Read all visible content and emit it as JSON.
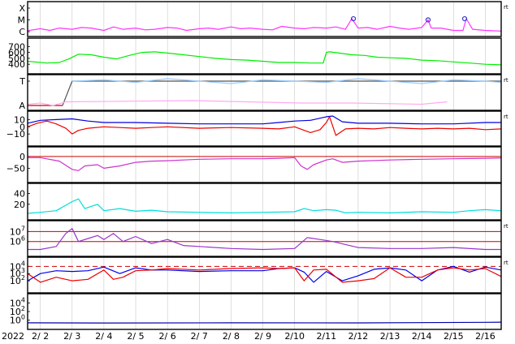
{
  "chart_data": {
    "type": "line",
    "year_label": "2022",
    "x_tick_labels": [
      "2/ 2",
      "2/ 3",
      "2/ 4",
      "2/ 5",
      "2/ 6",
      "2/ 7",
      "2/ 8",
      "2/ 9",
      "2/10",
      "2/11",
      "2/12",
      "2/13",
      "2/14",
      "2/15",
      "2/16"
    ],
    "x_range": [
      1.6,
      16.5
    ],
    "panels": [
      {
        "id": "xray",
        "tick_labels": [
          "X",
          "M",
          "C"
        ],
        "right_mark": "rt",
        "series": [
          {
            "color": "#ff33ff",
            "x": [
              1.6,
              2.0,
              2.3,
              2.6,
              3.0,
              3.3,
              3.6,
              4.0,
              4.3,
              4.6,
              5.0,
              5.3,
              5.6,
              6.0,
              6.3,
              6.6,
              7.0,
              7.3,
              7.6,
              8.0,
              8.3,
              8.6,
              9.0,
              9.3,
              9.6,
              10.0,
              10.3,
              10.6,
              11.0,
              11.3,
              11.6,
              11.8,
              12.0,
              12.3,
              12.6,
              13.0,
              13.3,
              13.6,
              14.0,
              14.2,
              14.3,
              14.6,
              15.0,
              15.3,
              15.4,
              15.6,
              16.0,
              16.5
            ],
            "y": [
              0.08,
              0.25,
              0.1,
              0.3,
              0.2,
              0.35,
              0.3,
              0.1,
              0.4,
              0.2,
              0.3,
              0.15,
              0.2,
              0.35,
              0.3,
              0.1,
              0.25,
              0.3,
              0.2,
              0.4,
              0.25,
              0.3,
              0.2,
              0.15,
              0.45,
              0.3,
              0.25,
              0.35,
              0.3,
              0.4,
              0.2,
              1.1,
              0.3,
              0.35,
              0.2,
              0.45,
              0.3,
              0.2,
              0.35,
              1.0,
              0.3,
              0.3,
              0.1,
              0.1,
              1.1,
              0.2,
              0.1,
              0.05
            ]
          }
        ],
        "markers": [
          {
            "x": 11.85,
            "y": 1.1
          },
          {
            "x": 14.2,
            "y": 1.0
          },
          {
            "x": 15.35,
            "y": 1.1
          }
        ]
      },
      {
        "id": "wind_speed",
        "tick_labels": [
          "700",
          "600",
          "500",
          "400"
        ],
        "tick_values": [
          700,
          600,
          500,
          400
        ],
        "y_range": [
          320,
          760
        ],
        "series": [
          {
            "color": "#00ee00",
            "x": [
              1.6,
              2.2,
              2.6,
              2.9,
              3.2,
              3.6,
              4.0,
              4.4,
              4.8,
              5.2,
              5.6,
              6.0,
              6.5,
              7.0,
              7.5,
              8.0,
              8.5,
              9.0,
              9.5,
              10.0,
              10.5,
              10.9,
              11.0,
              11.1,
              11.4,
              11.8,
              12.2,
              12.6,
              13.0,
              13.5,
              14.0,
              14.5,
              15.0,
              15.5,
              16.0,
              16.5
            ],
            "y": [
              450,
              420,
              430,
              490,
              570,
              560,
              520,
              490,
              550,
              600,
              610,
              590,
              560,
              530,
              500,
              480,
              470,
              450,
              430,
              430,
              420,
              420,
              600,
              610,
              590,
              560,
              550,
              520,
              510,
              500,
              470,
              460,
              440,
              420,
              400,
              390
            ]
          }
        ]
      },
      {
        "id": "magnetic_sector",
        "tick_labels": [
          "T",
          "A"
        ],
        "right_mark": "rt",
        "series": [
          {
            "color": "#cc0000",
            "x": [
              1.6,
              2.7
            ],
            "y": [
              0.0,
              0.0
            ]
          },
          {
            "color": "#555555",
            "x": [
              2.7,
              3.0,
              16.5
            ],
            "y": [
              0.0,
              1.0,
              1.0
            ]
          },
          {
            "color": "#99ccff",
            "x": [
              3.0,
              4.0,
              5.0,
              6.0,
              7.0,
              8.0,
              9.0,
              10.0,
              11.0,
              12.0,
              13.0,
              14.0,
              15.0,
              16.0,
              16.5
            ],
            "y": [
              1.0,
              1.05,
              0.95,
              1.1,
              1.0,
              0.9,
              1.05,
              1.0,
              0.95,
              1.1,
              1.0,
              0.9,
              1.05,
              1.0,
              0.95
            ]
          },
          {
            "color": "#ffaaee",
            "x": [
              1.6,
              2.0,
              2.4,
              2.8,
              6.8,
              10.2,
              11.8,
              14.0,
              14.8
            ],
            "y": [
              0.05,
              0.1,
              0.0,
              0.15,
              0.2,
              0.1,
              0.1,
              0.05,
              0.15
            ]
          }
        ]
      },
      {
        "id": "imf_bz_bt",
        "tick_labels": [
          "10",
          "0",
          "−10"
        ],
        "tick_values": [
          10,
          0,
          -10
        ],
        "y_range": [
          -20,
          15
        ],
        "right_mark": "rt",
        "series": [
          {
            "color": "#0000dd",
            "x": [
              1.6,
              2.0,
              2.5,
              3.0,
              3.5,
              4.0,
              5.0,
              6.0,
              7.0,
              8.0,
              9.0,
              9.5,
              10.0,
              10.5,
              11.0,
              11.2,
              11.5,
              12.0,
              13.0,
              14.0,
              15.0,
              16.0,
              16.5
            ],
            "y": [
              5,
              9,
              10,
              11,
              8,
              6,
              6,
              5,
              4,
              4,
              4,
              6,
              8,
              9,
              14,
              15,
              7,
              5,
              5,
              4,
              4,
              6,
              6
            ]
          },
          {
            "color": "#ee0000",
            "x": [
              1.6,
              1.9,
              2.2,
              2.5,
              2.8,
              3.0,
              3.2,
              3.5,
              4.0,
              4.5,
              5.0,
              5.5,
              6.0,
              7.0,
              8.0,
              9.0,
              9.5,
              10.0,
              10.5,
              10.8,
              11.0,
              11.1,
              11.3,
              11.6,
              12.0,
              12.5,
              13.0,
              13.5,
              14.0,
              14.5,
              15.0,
              15.5,
              16.0,
              16.5
            ],
            "y": [
              0,
              5,
              8,
              4,
              -2,
              -10,
              -5,
              -2,
              0,
              -1,
              -2,
              -1,
              0,
              -2,
              -1,
              -2,
              -3,
              0,
              -8,
              -4,
              6,
              14,
              -12,
              -3,
              -2,
              -3,
              -1,
              -2,
              -3,
              -2,
              -3,
              -2,
              -4,
              -3
            ]
          }
        ]
      },
      {
        "id": "dst",
        "tick_labels": [
          "0",
          "−50"
        ],
        "tick_values": [
          0,
          -50
        ],
        "y_range": [
          -90,
          20
        ],
        "series": [
          {
            "color": "#cc33cc",
            "x": [
              1.6,
              2.0,
              2.6,
              3.0,
              3.2,
              3.4,
              3.8,
              4.0,
              4.5,
              5.0,
              5.5,
              6.0,
              6.5,
              7.0,
              8.0,
              9.0,
              9.5,
              10.0,
              10.2,
              10.4,
              10.6,
              11.0,
              11.2,
              11.5,
              12.0,
              13.0,
              14.0,
              15.0,
              16.0,
              16.5
            ],
            "y": [
              -5,
              -5,
              -20,
              -55,
              -60,
              -40,
              -35,
              -50,
              -40,
              -25,
              -20,
              -18,
              -15,
              -12,
              -10,
              -10,
              -8,
              -5,
              -40,
              -55,
              -35,
              -15,
              -10,
              -25,
              -20,
              -15,
              -12,
              -10,
              -8,
              -6
            ]
          }
        ],
        "ref_line": {
          "color": "#cc0000",
          "y": 0
        }
      },
      {
        "id": "kp",
        "tick_labels": [
          "40",
          "20"
        ],
        "tick_values": [
          40,
          20
        ],
        "y_range": [
          0,
          50
        ],
        "series": [
          {
            "color": "#00dddd",
            "x": [
              1.6,
              2.0,
              2.5,
              3.0,
              3.2,
              3.4,
              3.8,
              4.0,
              4.5,
              5.0,
              5.5,
              6.0,
              7.0,
              8.0,
              9.0,
              10.0,
              10.3,
              10.6,
              11.0,
              11.3,
              11.6,
              12.0,
              13.0,
              14.0,
              15.0,
              15.5,
              16.0,
              16.5
            ],
            "y": [
              3,
              5,
              8,
              25,
              30,
              12,
              20,
              8,
              12,
              7,
              9,
              6,
              5,
              4,
              5,
              6,
              12,
              8,
              10,
              9,
              4,
              5,
              4,
              6,
              5,
              8,
              10,
              8
            ]
          }
        ]
      },
      {
        "id": "proton_flux",
        "tick_labels": [
          "10^7",
          "10^6"
        ],
        "tick_values": [
          7,
          6
        ],
        "y_range": [
          5.0,
          7.6
        ],
        "right_mark": "rt",
        "series": [
          {
            "color": "#9933cc",
            "x": [
              1.6,
              2.0,
              2.5,
              2.8,
              3.0,
              3.2,
              3.5,
              3.8,
              4.0,
              4.3,
              4.6,
              5.0,
              5.5,
              6.0,
              6.5,
              7.0,
              8.0,
              9.0,
              10.0,
              10.4,
              10.8,
              11.2,
              11.6,
              12.0,
              13.0,
              14.0,
              15.0,
              16.0,
              16.5
            ],
            "y": [
              5.2,
              5.2,
              5.5,
              6.8,
              7.3,
              6.0,
              6.3,
              6.6,
              6.2,
              6.8,
              6.0,
              6.5,
              5.8,
              6.2,
              5.6,
              5.5,
              5.3,
              5.2,
              5.3,
              6.4,
              6.2,
              6.0,
              5.7,
              5.4,
              5.3,
              5.3,
              5.4,
              5.2,
              5.2
            ]
          }
        ],
        "ref_lines": [
          {
            "color": "#cc0000",
            "y": 7
          },
          {
            "color": "#cc0000",
            "y": 6
          }
        ]
      },
      {
        "id": "electron_flux",
        "tick_labels": [
          "10^4",
          "10^3",
          "10^2"
        ],
        "tick_values": [
          4,
          3,
          2
        ],
        "y_range": [
          1.0,
          4.6
        ],
        "right_mark": "rt",
        "series": [
          {
            "color": "#0000ee",
            "x": [
              1.6,
              2.0,
              2.5,
              3.0,
              3.5,
              4.0,
              4.5,
              5.0,
              5.5,
              6.0,
              7.0,
              8.0,
              9.0,
              9.5,
              10.0,
              10.3,
              10.6,
              11.0,
              11.5,
              12.0,
              12.5,
              13.0,
              13.5,
              14.0,
              14.5,
              15.0,
              15.5,
              16.0,
              16.5
            ],
            "y": [
              2.0,
              3.0,
              3.4,
              3.3,
              3.4,
              3.9,
              3.0,
              3.8,
              3.5,
              3.5,
              3.3,
              3.4,
              3.4,
              3.7,
              3.8,
              3.2,
              1.8,
              3.3,
              2.0,
              2.7,
              3.6,
              3.8,
              3.5,
              2.0,
              3.5,
              4.0,
              3.2,
              3.9,
              3.5
            ]
          },
          {
            "color": "#ee0000",
            "x": [
              1.6,
              2.0,
              2.5,
              3.0,
              3.5,
              4.0,
              4.3,
              4.6,
              5.0,
              5.5,
              6.0,
              7.0,
              8.0,
              9.0,
              9.5,
              10.0,
              10.3,
              10.6,
              11.0,
              11.5,
              12.0,
              12.5,
              13.0,
              13.5,
              14.0,
              14.5,
              15.0,
              15.5,
              16.0,
              16.5
            ],
            "y": [
              3.0,
              1.8,
              2.5,
              2.0,
              2.2,
              3.5,
              2.2,
              2.5,
              3.4,
              3.5,
              3.7,
              3.5,
              3.7,
              3.8,
              3.7,
              3.8,
              2.0,
              3.5,
              3.6,
              1.8,
              2.0,
              2.3,
              3.8,
              2.5,
              2.5,
              3.5,
              3.8,
              3.5,
              3.7,
              2.6
            ]
          }
        ],
        "ref_line": {
          "color": "#cc0000",
          "y": 4,
          "dashed": true
        }
      },
      {
        "id": "high_energy_electrons",
        "tick_labels": [
          "10^4",
          "10^2",
          "10^0"
        ],
        "tick_values": [
          4,
          2,
          0
        ],
        "y_range": [
          -1.0,
          5.0
        ],
        "series": [
          {
            "color": "#0000aa",
            "x": [
              1.6,
              4.0,
              8.0,
              12.0,
              16.0,
              16.5
            ],
            "y": [
              -0.6,
              -0.65,
              -0.6,
              -0.62,
              -0.5,
              -0.45
            ]
          }
        ]
      }
    ]
  }
}
